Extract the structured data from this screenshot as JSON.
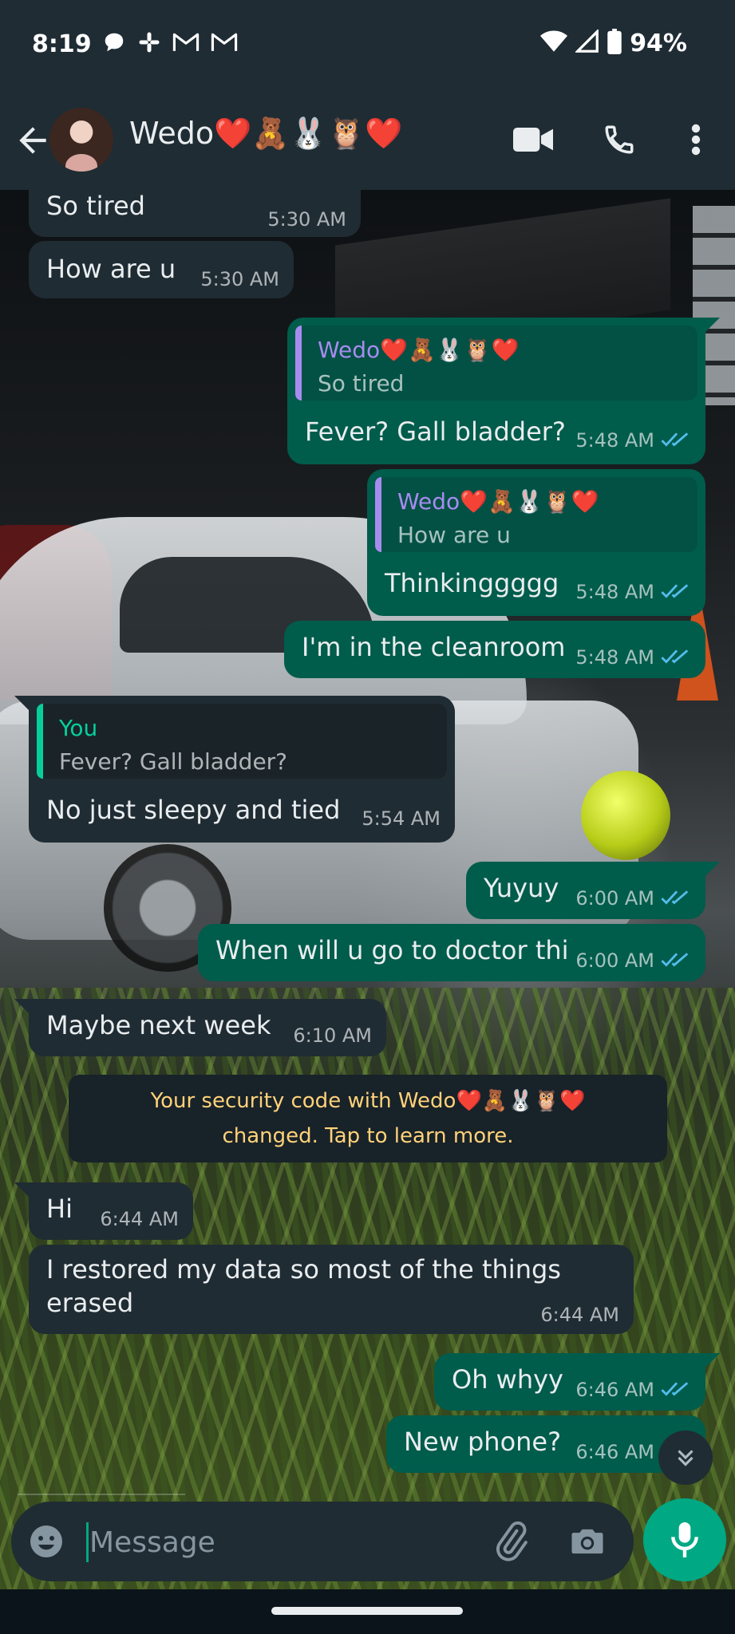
{
  "status": {
    "time": "8:19",
    "battery": "94%",
    "left_icons": [
      "chat-bubble-icon",
      "slack-icon",
      "gmail-icon",
      "gmail-icon"
    ]
  },
  "header": {
    "contact_name": "Wedo❤️🧸🐰🦉❤️"
  },
  "messages": [
    {
      "id": "m1",
      "dir": "in",
      "text": "So tired",
      "time": "5:30 AM"
    },
    {
      "id": "m2",
      "dir": "in",
      "text": "How are u",
      "time": "5:30 AM"
    },
    {
      "id": "m3",
      "dir": "out",
      "quote_name": "Wedo❤️🧸🐰🦉❤️",
      "quote_text": "So tired",
      "text": "Fever? Gall bladder?",
      "time": "5:48 AM",
      "read": true
    },
    {
      "id": "m4",
      "dir": "out",
      "quote_name": "Wedo❤️🧸🐰🦉❤️",
      "quote_text": "How are u",
      "text": "Thinkinggggg",
      "time": "5:48 AM",
      "read": true
    },
    {
      "id": "m5",
      "dir": "out",
      "text": "I'm in the cleanroom",
      "time": "5:48 AM",
      "read": true
    },
    {
      "id": "m6",
      "dir": "in",
      "quote_name": "You",
      "quote_text": "Fever? Gall bladder?",
      "text": "No just sleepy and tied",
      "time": "5:54 AM"
    },
    {
      "id": "m7",
      "dir": "out",
      "text": "Yuyuy",
      "time": "6:00 AM",
      "read": true
    },
    {
      "id": "m8",
      "dir": "out",
      "text": "When will u go to doctor thi",
      "time": "6:00 AM",
      "read": true
    },
    {
      "id": "m9",
      "dir": "in",
      "text": "Maybe next week",
      "time": "6:10 AM"
    },
    {
      "id": "m10",
      "dir": "in",
      "text": "Hi",
      "time": "6:44 AM"
    },
    {
      "id": "m11",
      "dir": "in",
      "text_line1": "I restored my data so most of the things",
      "text_line2": "erased",
      "time": "6:44 AM"
    },
    {
      "id": "m12",
      "dir": "out",
      "text": "Oh whyy",
      "time": "6:46 AM",
      "read": true
    },
    {
      "id": "m13",
      "dir": "out",
      "text": "New phone?",
      "time": "6:46 AM",
      "read": true
    }
  ],
  "system_notice": {
    "line1": "Your security code with Wedo❤️🧸🐰🦉❤️",
    "line2": "changed. Tap to learn more."
  },
  "composer": {
    "placeholder": "Message"
  },
  "colors": {
    "header_bg": "#1f2c34",
    "incoming_bubble": "#202c33",
    "outgoing_bubble": "#005c4b",
    "quote_name_contact": "#a78cf0",
    "quote_name_you": "#06cf9c",
    "read_ticks": "#53bdeb",
    "system_text": "#ffd279",
    "accent": "#00a884"
  }
}
